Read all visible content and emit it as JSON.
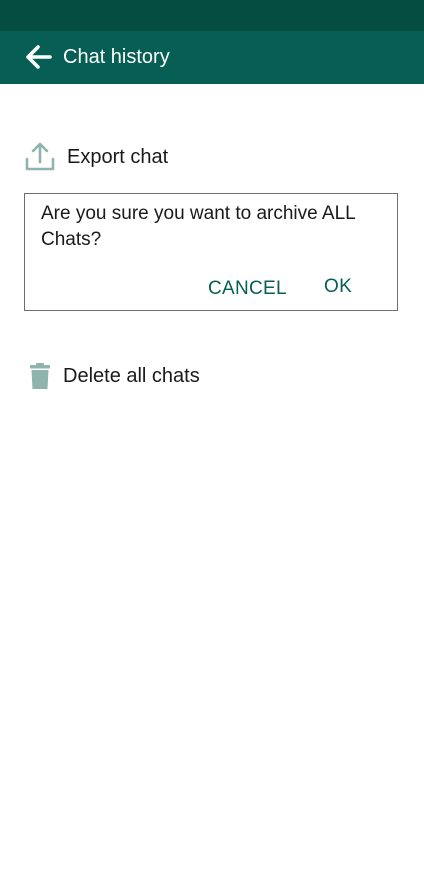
{
  "app_bar": {
    "title": "Chat history",
    "back_icon": "arrow-left-icon"
  },
  "menu": {
    "export": {
      "label": "Export chat",
      "icon": "upload-icon"
    },
    "delete": {
      "label": "Delete all chats",
      "icon": "trash-icon"
    }
  },
  "dialog": {
    "message": "Are you sure you want to archive ALL Chats?",
    "cancel_label": "CANCEL",
    "ok_label": "OK"
  },
  "colors": {
    "status_bar": "#054d40",
    "app_bar": "#075e54",
    "accent": "#075e54",
    "icon_muted": "#8fb3ad"
  }
}
